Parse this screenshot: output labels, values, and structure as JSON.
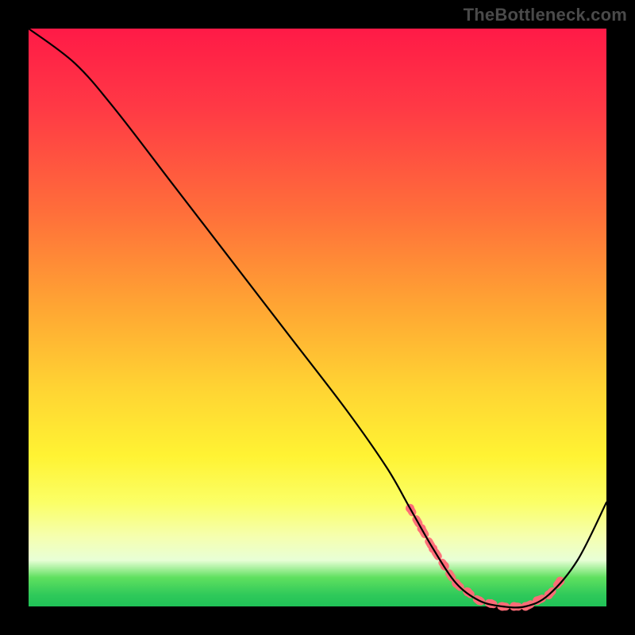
{
  "watermark": "TheBottleneck.com",
  "colors": {
    "background": "#000000",
    "gradient_top": "#ff1a47",
    "gradient_mid": "#ffd333",
    "gradient_bottom": "#20c257",
    "curve": "#000000",
    "highlight": "#ff6b77"
  },
  "chart_data": {
    "type": "line",
    "title": "",
    "xlabel": "",
    "ylabel": "",
    "xlim": [
      0,
      100
    ],
    "ylim": [
      0,
      100
    ],
    "grid": false,
    "legend": false,
    "series": [
      {
        "name": "bottleneck-curve",
        "x": [
          0,
          8,
          15,
          25,
          35,
          45,
          55,
          62,
          66,
          70,
          74,
          78,
          82,
          86,
          90,
          95,
          100
        ],
        "values": [
          100,
          94,
          86,
          73,
          60,
          47,
          34,
          24,
          17,
          10,
          4,
          1,
          0,
          0,
          2,
          8,
          18
        ]
      }
    ],
    "highlight_range_x": [
      66,
      92
    ],
    "highlight_dots_x": [
      66,
      68,
      70,
      72,
      74,
      76,
      78,
      80,
      82,
      84,
      86,
      88,
      90,
      92
    ],
    "note": "x and y are percentages of the visible plot area; the curve descends from top-left, bottoms out in a flat minimum around x≈78–88, then rises toward the right edge. The pink dashed/dotted segment highlights the near-minimum region."
  }
}
